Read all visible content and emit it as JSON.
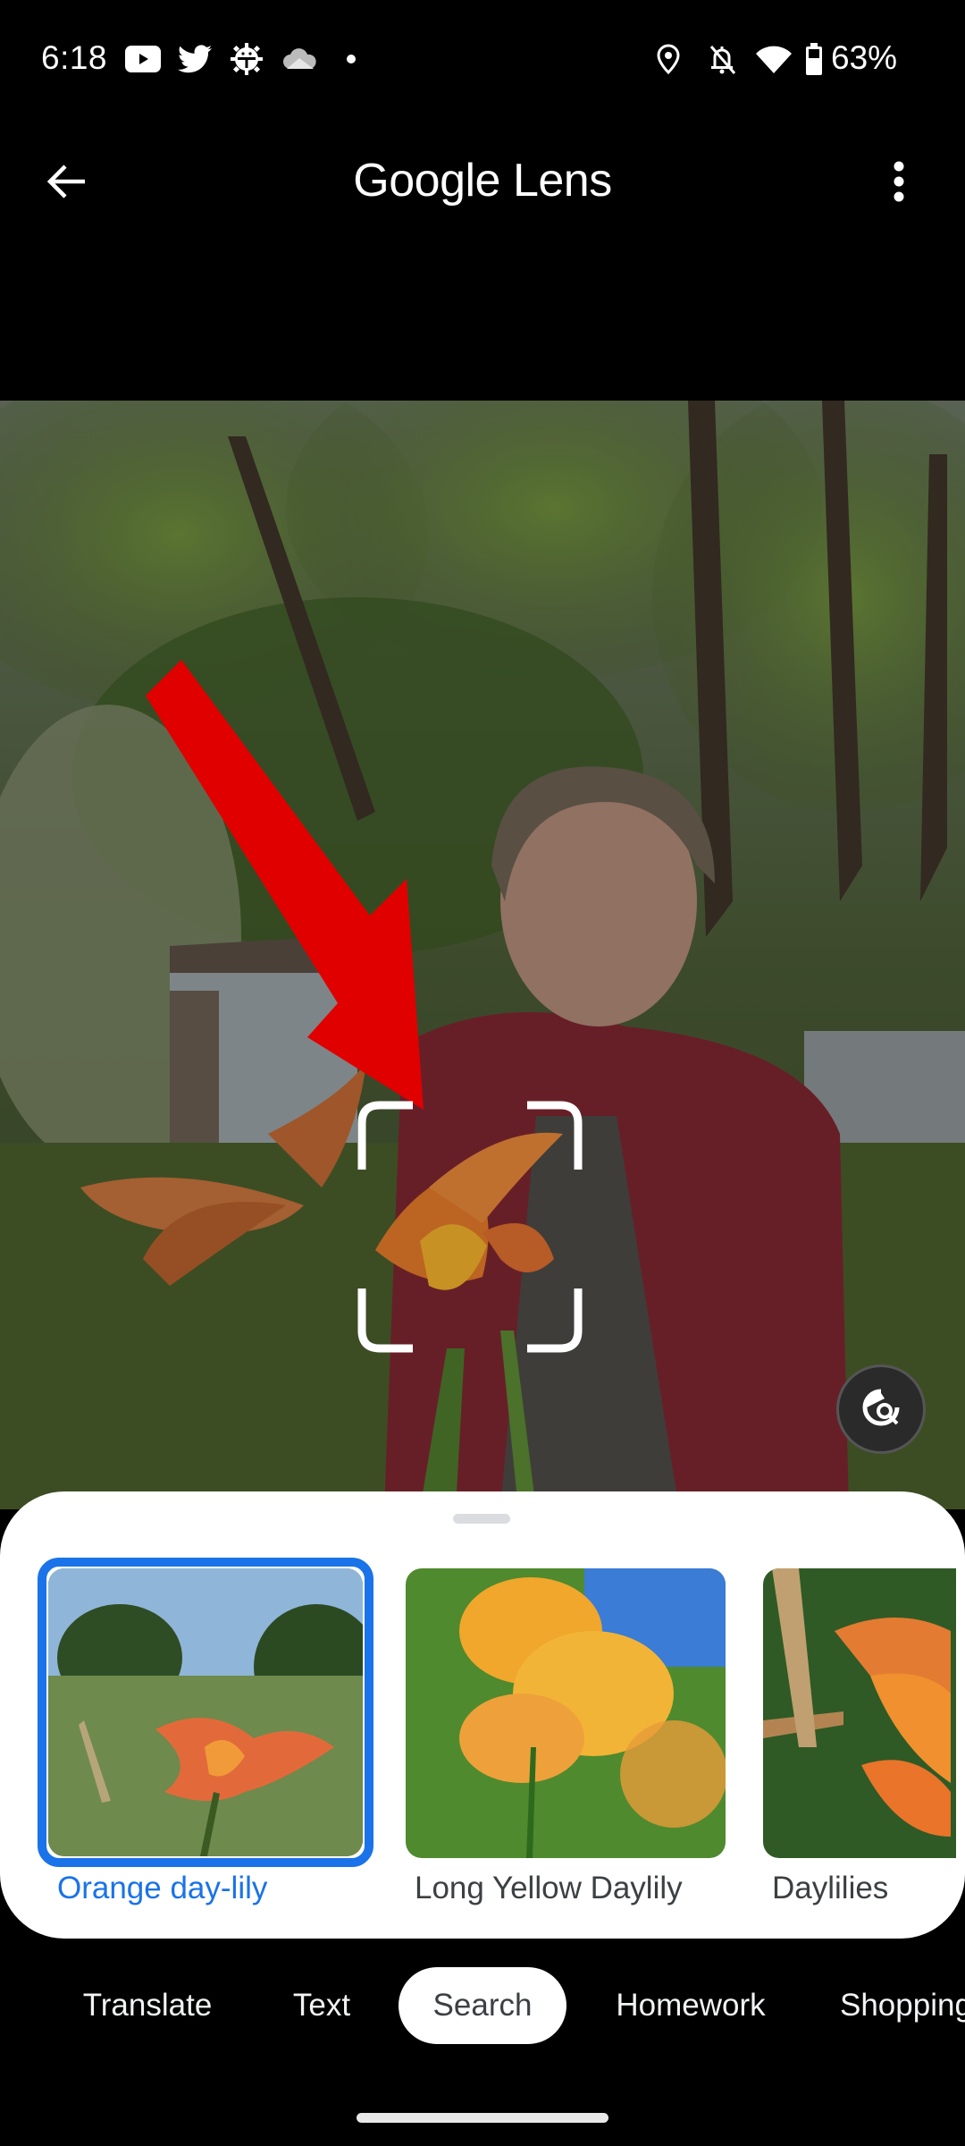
{
  "status_bar": {
    "time": "6:18",
    "left_icons": [
      "youtube-icon",
      "twitter-icon",
      "android-debug-icon",
      "cloud-icon",
      "dot-icon"
    ],
    "right_icons": [
      "location-icon",
      "bell-off-icon",
      "wifi-icon",
      "battery-icon"
    ],
    "battery_percent": "63%"
  },
  "app_bar": {
    "title_brand": "Google",
    "title_product": "Lens",
    "back_icon": "arrow-back-icon",
    "menu_icon": "more-vert-icon"
  },
  "photo": {
    "description": "Man in red hoodie holding orange day-lily in a backyard",
    "annotation": "red-arrow pointing to flower",
    "selection": "crop-corners-icon"
  },
  "visual_search_button": {
    "icon": "image-search-icon"
  },
  "results": [
    {
      "label": "Orange day-lily",
      "selected": true
    },
    {
      "label": "Long Yellow Daylily",
      "selected": false
    },
    {
      "label": "Daylilies",
      "selected": false
    }
  ],
  "mode_tabs": [
    {
      "label": "Translate",
      "active": false
    },
    {
      "label": "Text",
      "active": false
    },
    {
      "label": "Search",
      "active": true
    },
    {
      "label": "Homework",
      "active": false
    },
    {
      "label": "Shopping",
      "active": false
    }
  ],
  "colors": {
    "accent": "#1a73e8",
    "arrow": "#e00000",
    "sheet_bg": "#ffffff",
    "app_bg": "#000000"
  }
}
